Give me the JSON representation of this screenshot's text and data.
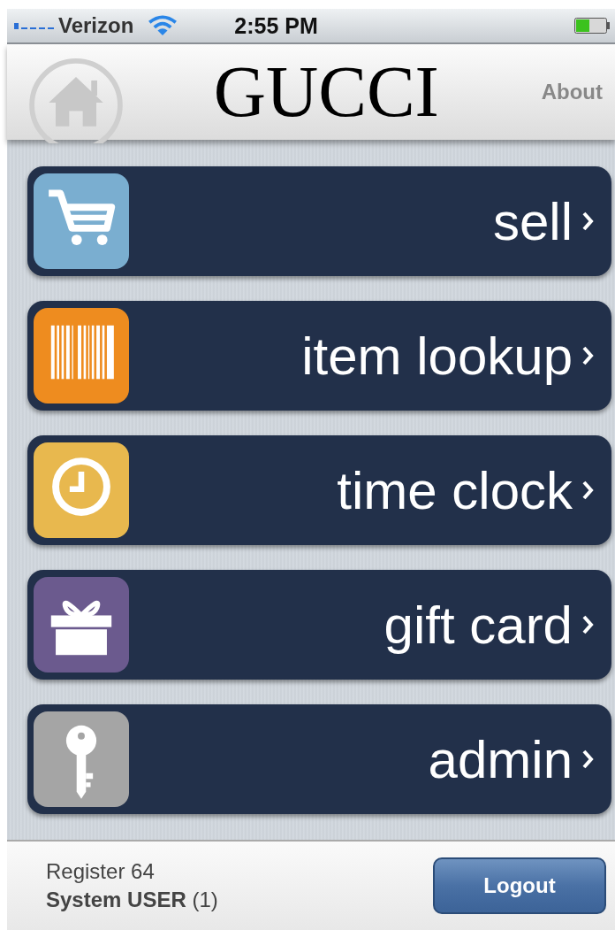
{
  "status_bar": {
    "carrier": "Verizon",
    "time": "2:55 PM"
  },
  "nav_bar": {
    "title": "GUCCI",
    "about": "About"
  },
  "menu": [
    {
      "label": "sell",
      "kind": "cart",
      "color": "#7aaed0"
    },
    {
      "label": "item lookup",
      "kind": "barcode",
      "color": "#ee8c1f"
    },
    {
      "label": "time clock",
      "kind": "clock",
      "color": "#e8b84e"
    },
    {
      "label": "gift card",
      "kind": "gift",
      "color": "#6b5a8e"
    },
    {
      "label": "admin",
      "kind": "key",
      "color": "#a5a5a5"
    }
  ],
  "footer": {
    "register": "Register 64",
    "user": "**System USER** (1)",
    "logout": "Logout"
  }
}
